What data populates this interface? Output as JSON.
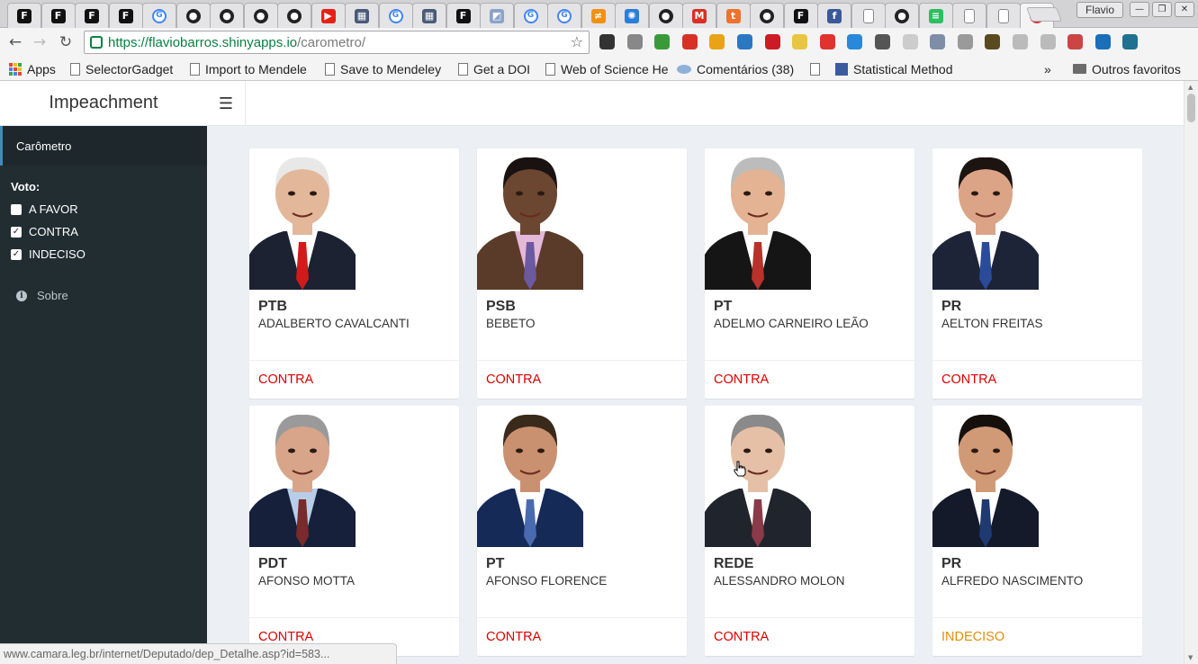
{
  "browser": {
    "tabs": [
      {
        "icon": "f-icon",
        "color": "#111111",
        "glyph": "F"
      },
      {
        "icon": "f-icon",
        "color": "#111111",
        "glyph": "F"
      },
      {
        "icon": "f-icon",
        "color": "#111111",
        "glyph": "F"
      },
      {
        "icon": "f-icon",
        "color": "#111111",
        "glyph": "F"
      },
      {
        "icon": "google-icon",
        "color": "#4285f4",
        "glyph": "G"
      },
      {
        "icon": "github-icon",
        "color": "#222222",
        "glyph": "●"
      },
      {
        "icon": "github-icon",
        "color": "#222222",
        "glyph": "●"
      },
      {
        "icon": "github-icon",
        "color": "#222222",
        "glyph": "●"
      },
      {
        "icon": "github-icon",
        "color": "#222222",
        "glyph": "●"
      },
      {
        "icon": "youtube-icon",
        "color": "#e62117",
        "glyph": "▶"
      },
      {
        "icon": "doc-grid-icon",
        "color": "#4a5a78",
        "glyph": "▦"
      },
      {
        "icon": "google-icon",
        "color": "#4285f4",
        "glyph": "G"
      },
      {
        "icon": "doc-grid-icon",
        "color": "#4a5a78",
        "glyph": "▦"
      },
      {
        "icon": "f-icon",
        "color": "#111111",
        "glyph": "F"
      },
      {
        "icon": "image-icon",
        "color": "#8aa3c9",
        "glyph": "◩"
      },
      {
        "icon": "google-icon",
        "color": "#4285f4",
        "glyph": "G"
      },
      {
        "icon": "google-icon",
        "color": "#4285f4",
        "glyph": "G"
      },
      {
        "icon": "feather-icon",
        "color": "#f29111",
        "glyph": "≠"
      },
      {
        "icon": "gear-ring-icon",
        "color": "#2a7ed8",
        "glyph": "✺"
      },
      {
        "icon": "github-icon",
        "color": "#222222",
        "glyph": "●"
      },
      {
        "icon": "gmail-icon",
        "color": "#d93025",
        "glyph": "M"
      },
      {
        "icon": "tumblr-icon",
        "color": "#f0722c",
        "glyph": "t"
      },
      {
        "icon": "github-icon",
        "color": "#222222",
        "glyph": "●"
      },
      {
        "icon": "f-icon",
        "color": "#111111",
        "glyph": "F"
      },
      {
        "icon": "facebook-icon",
        "color": "#3b5998",
        "glyph": "f"
      },
      {
        "icon": "blank-page-icon",
        "color": "#ffffff",
        "glyph": ""
      },
      {
        "icon": "github-icon",
        "color": "#222222",
        "glyph": "●"
      },
      {
        "icon": "evernote-icon",
        "color": "#2dbe60",
        "glyph": "≡"
      },
      {
        "icon": "blank-page-icon",
        "color": "#ffffff",
        "glyph": ""
      },
      {
        "icon": "blank-page-icon",
        "color": "#ffffff",
        "glyph": ""
      },
      {
        "icon": "error-icon",
        "color": "#e0332e",
        "glyph": "✕",
        "active": true
      }
    ],
    "profile_name": "Flavio",
    "url_scheme": "https://",
    "url_host": "flaviobarros.shinyapps.io",
    "url_path": "/carometro/",
    "extensions": [
      {
        "name": "keep-icon",
        "color": "#333333"
      },
      {
        "name": "tag-icon",
        "color": "#888888"
      },
      {
        "name": "grammar-icon",
        "color": "#3a9a3a"
      },
      {
        "name": "gmail-ext-icon",
        "color": "#d93025"
      },
      {
        "name": "sun-ext-icon",
        "color": "#e8a317"
      },
      {
        "name": "bookmark-ext-icon",
        "color": "#2b78c2"
      },
      {
        "name": "opera-ext-icon",
        "color": "#cc1b24"
      },
      {
        "name": "notes-ext-icon",
        "color": "#e8c642"
      },
      {
        "name": "pocket-ext-icon",
        "color": "#e0332e"
      },
      {
        "name": "drop-ext-icon",
        "color": "#2a88d8"
      },
      {
        "name": "x-tools-icon",
        "color": "#555555"
      },
      {
        "name": "shield-ext-icon",
        "color": "#cccccc"
      },
      {
        "name": "cloud-ext-icon",
        "color": "#7e8ea8"
      },
      {
        "name": "r-ext-icon",
        "color": "#9a9a9a"
      },
      {
        "name": "camera-ext-icon",
        "color": "#5a4a20"
      },
      {
        "name": "page-ext-icon",
        "color": "#bbbbbb"
      },
      {
        "name": "circle-ext-icon",
        "color": "#bbbbbb"
      },
      {
        "name": "rainbow-ext-icon",
        "color": "#cc4444"
      },
      {
        "name": "o-ext-icon",
        "color": "#1a6fb8"
      },
      {
        "name": "screen-ext-icon",
        "color": "#207090"
      }
    ],
    "bookmarks": {
      "apps": "Apps",
      "items": [
        "SelectorGadget",
        "Import to Mendele",
        "Save to Mendeley",
        "Get a DOI",
        "Web of Science He",
        "Comentários (38)",
        "Statistical Method"
      ],
      "overflow": "»",
      "other_folder": "Outros favoritos"
    },
    "status_url": "www.camara.leg.br/internet/Deputado/dep_Detalhe.asp?id=583..."
  },
  "app": {
    "title": "Impeachment",
    "sidebar": {
      "active_item": "Carômetro",
      "filter_label": "Voto:",
      "options": [
        {
          "label": "A FAVOR",
          "checked": false
        },
        {
          "label": "CONTRA",
          "checked": true
        },
        {
          "label": "INDECISO",
          "checked": true
        }
      ],
      "about": "Sobre"
    },
    "vote_colors": {
      "CONTRA": "#dd0000",
      "INDECISO": "#e08e0b",
      "A FAVOR": "#00a65a"
    },
    "cards": [
      {
        "party": "PTB",
        "name": "ADALBERTO CAVALCANTI",
        "vote": "CONTRA"
      },
      {
        "party": "PSB",
        "name": "BEBETO",
        "vote": "CONTRA"
      },
      {
        "party": "PT",
        "name": "ADELMO CARNEIRO LEÃO",
        "vote": "CONTRA"
      },
      {
        "party": "PR",
        "name": "AELTON FREITAS",
        "vote": "CONTRA"
      },
      {
        "party": "PDT",
        "name": "AFONSO MOTTA",
        "vote": "CONTRA"
      },
      {
        "party": "PT",
        "name": "AFONSO FLORENCE",
        "vote": "CONTRA"
      },
      {
        "party": "REDE",
        "name": "ALESSANDRO MOLON",
        "vote": "CONTRA"
      },
      {
        "party": "PR",
        "name": "ALFREDO NASCIMENTO",
        "vote": "INDECISO"
      }
    ]
  }
}
